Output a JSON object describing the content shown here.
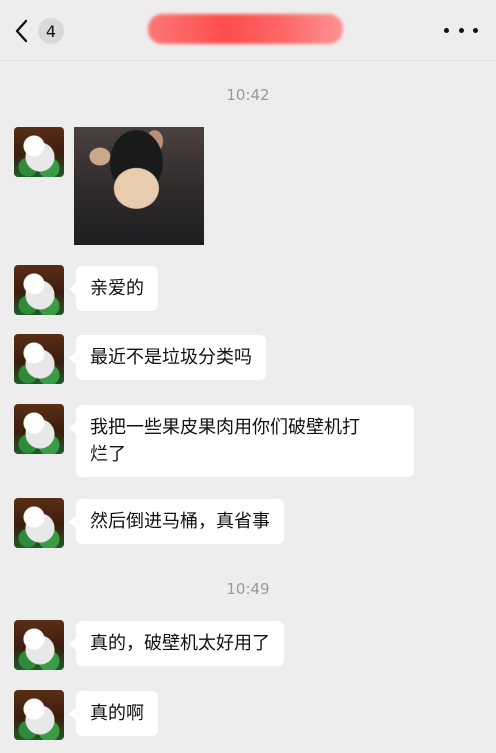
{
  "header": {
    "unread_count": "4",
    "back_icon": "chevron-left-icon",
    "more_icon": "more-dots-icon"
  },
  "messages": {
    "time1": "10:42",
    "msg2": "亲爱的",
    "msg3": "最近不是垃圾分类吗",
    "msg4_line1": "我把一些果皮果肉用你们破壁机打",
    "msg4_line2": "烂了",
    "msg5": "然后倒进马桶，真省事",
    "time2": "10:49",
    "msg6": "真的，破壁机太好用了",
    "msg7": "真的啊"
  }
}
